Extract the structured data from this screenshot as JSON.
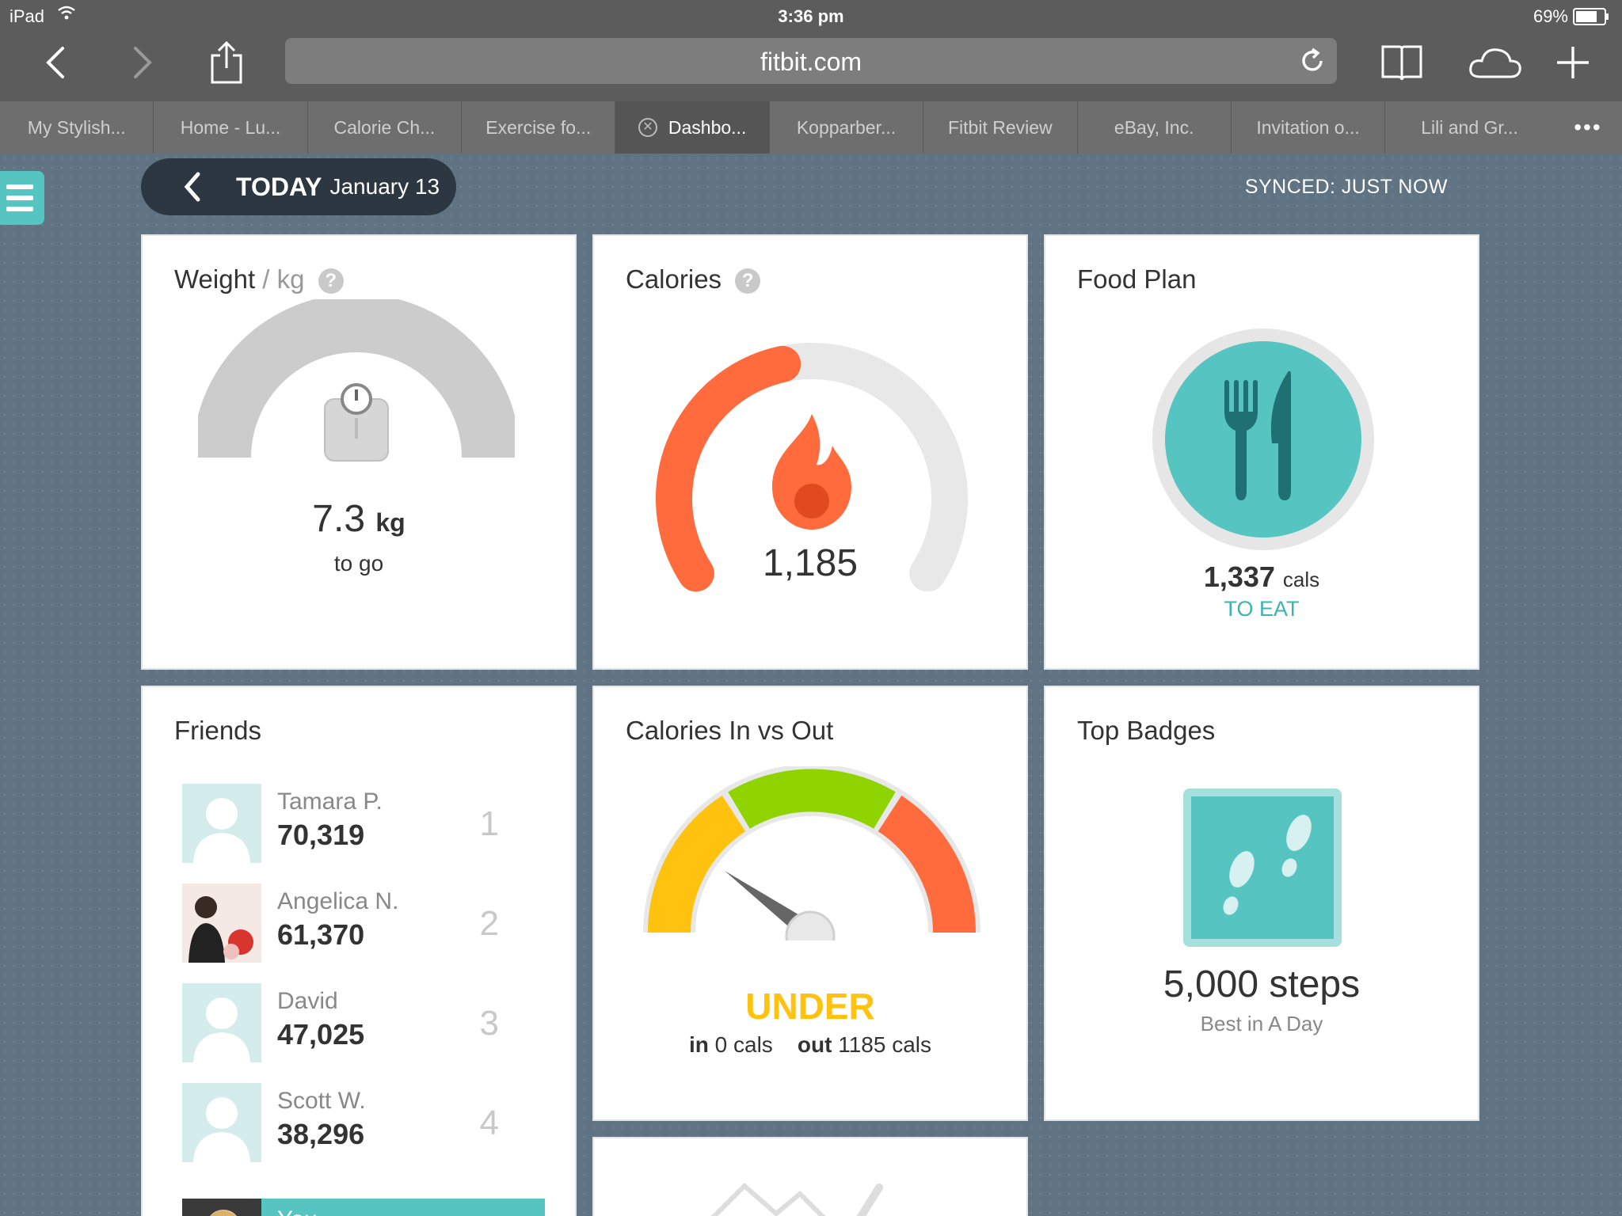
{
  "status_bar": {
    "device": "iPad",
    "time": "3:36 pm",
    "battery": "69%"
  },
  "browser": {
    "url": "fitbit.com"
  },
  "tabs": [
    {
      "label": "My Stylish..."
    },
    {
      "label": "Home - Lu..."
    },
    {
      "label": "Calorie Ch..."
    },
    {
      "label": "Exercise fo..."
    },
    {
      "label": "Dashbo...",
      "active": true
    },
    {
      "label": "Kopparber..."
    },
    {
      "label": "Fitbit Review"
    },
    {
      "label": "eBay, Inc."
    },
    {
      "label": "Invitation o..."
    },
    {
      "label": "Lili and Gr..."
    }
  ],
  "tabs_more": "•••",
  "header": {
    "today": "TODAY",
    "date": "January 13",
    "synced": "SYNCED: JUST NOW"
  },
  "weight": {
    "title": "Weight",
    "unit": "/ kg",
    "value": "7.3",
    "value_unit": "kg",
    "caption": "to go"
  },
  "calories": {
    "title": "Calories",
    "value": "1,185",
    "progress": 0.45
  },
  "food_plan": {
    "title": "Food Plan",
    "value": "1,337",
    "value_unit": "cals",
    "caption": "TO EAT"
  },
  "friends": {
    "title": "Friends",
    "items": [
      {
        "name": "Tamara P.",
        "steps": "70,319",
        "rank": "1"
      },
      {
        "name": "Angelica N.",
        "steps": "61,370",
        "rank": "2"
      },
      {
        "name": "David",
        "steps": "47,025",
        "rank": "3"
      },
      {
        "name": "Scott W.",
        "steps": "38,296",
        "rank": "4"
      }
    ],
    "you_label": "You"
  },
  "calories_in_out": {
    "title": "Calories In vs Out",
    "status": "UNDER",
    "in_label": "in",
    "in_value": "0 cals",
    "out_label": "out",
    "out_value": "1185 cals"
  },
  "top_badges": {
    "title": "Top Badges",
    "value": "5,000 steps",
    "caption": "Best in A Day"
  },
  "colors": {
    "teal": "#56c4c0",
    "orange": "#ff6b3d",
    "yellow": "#ffc20e",
    "green": "#8fd400",
    "page_bg": "#5f7383"
  },
  "icons": [
    "back-icon",
    "forward-icon",
    "share-icon",
    "reload-icon",
    "bookmarks-icon",
    "cloud-tabs-icon",
    "new-tab-icon",
    "menu-icon",
    "scale-icon",
    "flame-icon",
    "fork-knife-icon",
    "footprints-icon",
    "help-icon"
  ]
}
